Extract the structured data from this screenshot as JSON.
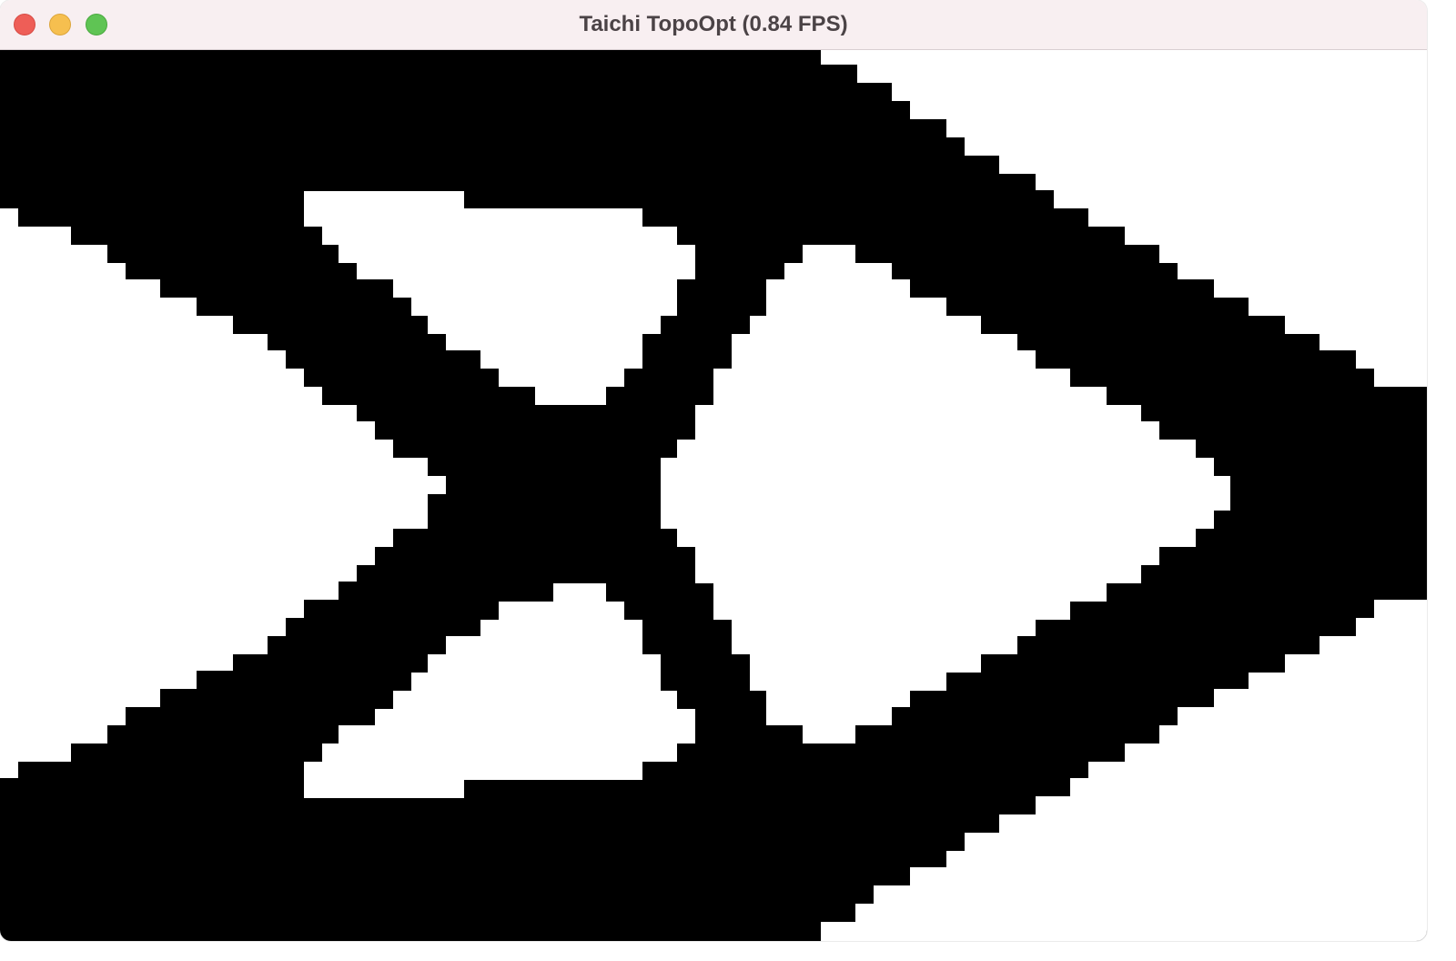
{
  "window": {
    "title": "Taichi TopoOpt (0.84 FPS)"
  },
  "traffic_lights": {
    "close": "close-button",
    "minimize": "minimize-button",
    "zoom": "zoom-button"
  },
  "colors": {
    "titlebar_bg": "#f8eff1",
    "title_text": "#4b4346",
    "close": "#ee5e57",
    "minimize": "#f6bf4f",
    "zoom": "#5fc454",
    "material": "#000000",
    "void": "#ffffff"
  },
  "density_grid": {
    "grid_cols": 80,
    "grid_rows": 50,
    "description_note": "binary topology-optimized truss, black = solid material"
  }
}
